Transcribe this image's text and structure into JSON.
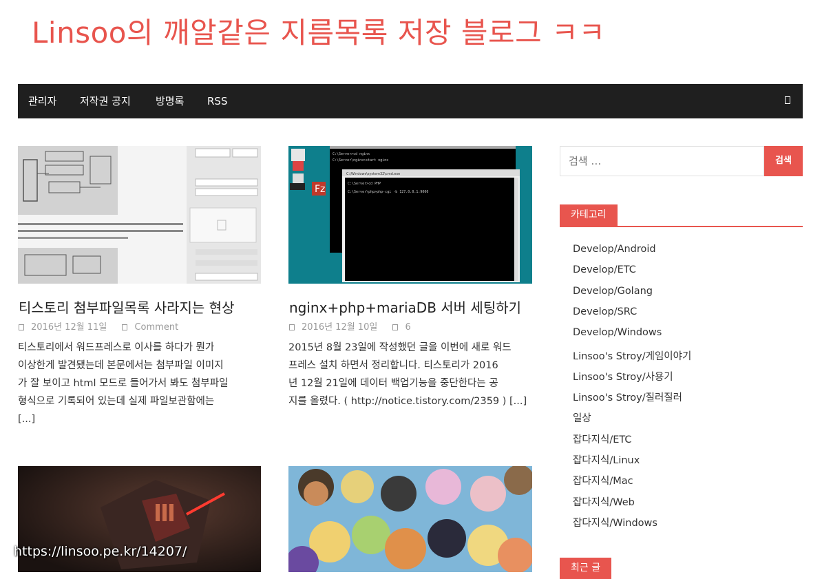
{
  "site": {
    "title": "Linsoo의 깨알같은 지름목록 저장 블로그 ㅋㅋ"
  },
  "nav": {
    "items": [
      "관리자",
      "저작권 공지",
      "방명록",
      "RSS"
    ],
    "search_icon": "search-icon"
  },
  "posts": [
    {
      "title": "티스토리 첨부파일목록 사라지는 현상",
      "date": "2016년 12월 11일",
      "comments": "Comment",
      "excerpt": [
        " 티스토리에서 워드프레스로 이사를 하다가 뭔가",
        "이상한게 발견됐는데 본문에서는 첨부파일 이미지",
        "가 잘 보이고 html 모드로 들어가서 봐도 첨부파일",
        "형식으로 기록되어 있는데 실제 파일보관함에는",
        "[...]"
      ]
    },
    {
      "title": "nginx+php+mariaDB 서버 세팅하기",
      "date": "2016년 12월 10일",
      "comments": "6",
      "excerpt": [
        "2015년 8월 23일에 작성했던 글을 이번에 새로 워드",
        "프레스 설치 하면서 정리합니다. 티스토리가 2016",
        "년 12월 21일에 데이터 백업기능을 중단한다는 공",
        "지를 올렸다. ( http://notice.tistory.com/2359 ) [...]"
      ]
    }
  ],
  "thumb2": {
    "cmd_line1": "C:\\Server>cd nginx",
    "cmd_line2": "C:\\Server\\nginx>start nginx",
    "window_title": "C:\\Windows\\system32\\cmd.exe",
    "cmd_line3": "C:\\Server>cd PHP",
    "cmd_line4": "C:\\Server\\php>php-cgi -b 127.0.0.1:9000"
  },
  "sidebar": {
    "search_placeholder": "검색 …",
    "search_button": "검색",
    "categories_title": "카테고리",
    "categories": [
      "Develop/Android",
      "Develop/ETC",
      "Develop/Golang",
      "Develop/SRC",
      "Develop/Windows",
      "Linsoo's Stroy/게임이야기",
      "Linsoo's Stroy/사용기",
      "Linsoo's Stroy/질러질러",
      "일상",
      "잡다지식/ETC",
      "잡다지식/Linux",
      "잡다지식/Mac",
      "잡다지식/Web",
      "잡다지식/Windows"
    ],
    "recent_title": "최근 글"
  },
  "overlay_url": "https://linsoo.pe.kr/14207/",
  "colors": {
    "accent": "#e8554e",
    "nav_bg": "#1f1f1f"
  }
}
